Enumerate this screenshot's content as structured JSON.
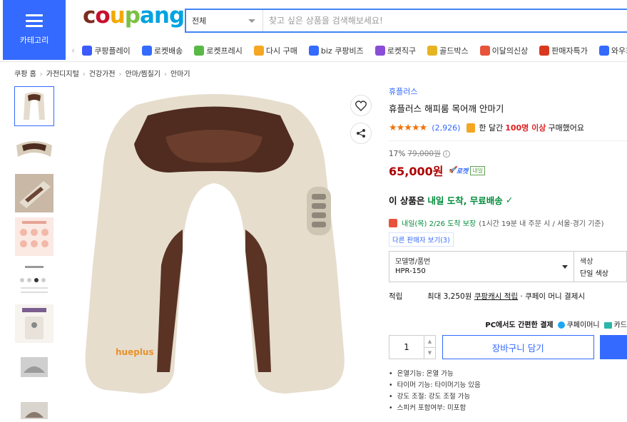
{
  "header": {
    "category_label": "카테고리",
    "logo_letters": [
      "c",
      "o",
      "u",
      "p",
      "ang"
    ],
    "search_category": "전체",
    "search_placeholder": "찾고 싶은 상품을 검색해보세요!",
    "quick_links": [
      {
        "label": "쿠팡플레이",
        "icon": "play-icon",
        "color": "#3b5bfd"
      },
      {
        "label": "로켓배송",
        "icon": "rocket-icon",
        "color": "#346aff"
      },
      {
        "label": "로켓프레시",
        "icon": "rocket-fresh-icon",
        "color": "#58b947"
      },
      {
        "label": "다시 구매",
        "icon": "rebuy-icon",
        "color": "#f5a623"
      },
      {
        "label": "biz 쿠팡비즈",
        "icon": "biz-icon",
        "color": "#346aff"
      },
      {
        "label": "로켓직구",
        "icon": "global-icon",
        "color": "#8a4dd8"
      },
      {
        "label": "골드박스",
        "icon": "goldbox-icon",
        "color": "#e6b422"
      },
      {
        "label": "이달의신상",
        "icon": "new-icon",
        "color": "#e8533b"
      },
      {
        "label": "판매자특가",
        "icon": "sale-icon",
        "color": "#d9381e"
      },
      {
        "label": "와우회원",
        "icon": "wow-icon",
        "color": "#346aff"
      }
    ]
  },
  "breadcrumbs": [
    "쿠팡 홈",
    "가전디지털",
    "건강가전",
    "안마/찜질기",
    "안마기"
  ],
  "product": {
    "brand": "휴플러스",
    "title": "휴플러스 해피룸 목어깨 안마기",
    "stars": "★★★★★",
    "review_count": "(2,926)",
    "buyers_prefix": "한 달간",
    "buyers_highlight": "100명 이상",
    "buyers_suffix": "구매했어요",
    "discount_rate": "17%",
    "original_price": "79,000원",
    "price": "65,000원",
    "rocket_label": "로켓",
    "rocket_tomorrow": "내일",
    "arrival_prefix": "이 상품은",
    "arrival_main": "내일 도착, 무료배송",
    "delivery_date": "내일(목) 2/26 도착 보장",
    "delivery_note": "(1시간 19분 내 주문 시 / 서울·경기 기준)",
    "other_sellers": "다른 판매자 보기(3)",
    "option1_key": "모델명/품번",
    "option1_value": "HPR-150",
    "option2_key": "색상",
    "option2_value": "단일 색상",
    "points_key": "적립",
    "points_prefix": "최대 3,250원",
    "points_link": "쿠팡캐시 적립",
    "points_suffix": "· 쿠페이 머니 결제시",
    "pay_text": "PC에서도 간편한 결제",
    "pay_method1": "쿠페이머니",
    "pay_method2": "카드",
    "quantity": "1",
    "cart_button": "장바구니 담기",
    "features": [
      "온열기능: 온열 가능",
      "타이머 기능: 타이머기능 있음",
      "강도 조절: 강도 조절 가능",
      "스피커 포함여부: 미포함"
    ],
    "image_logo": "hueplus"
  }
}
